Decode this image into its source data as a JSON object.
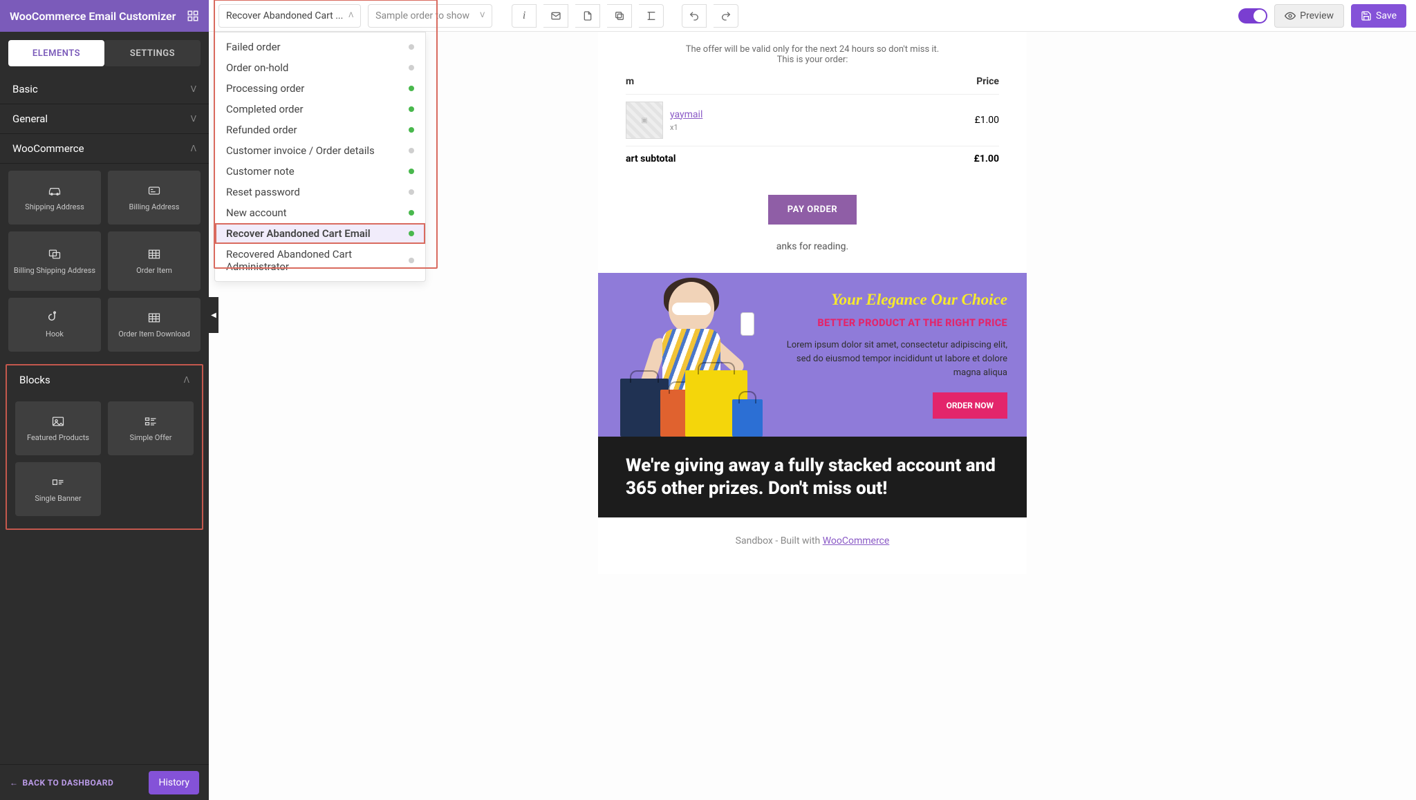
{
  "app": {
    "title": "WooCommerce Email Customizer"
  },
  "toolbar": {
    "template_dropdown": "Recover Abandoned Cart ...",
    "sample_dropdown": "Sample order to show",
    "preview_label": "Preview",
    "save_label": "Save"
  },
  "tabs": {
    "elements": "ELEMENTS",
    "settings": "SETTINGS"
  },
  "accordions": {
    "basic": "Basic",
    "general": "General",
    "woocommerce": "WooCommerce",
    "blocks": "Blocks"
  },
  "tiles": {
    "shipping_address": "Shipping Address",
    "billing_address": "Billing Address",
    "billing_shipping_address": "Billing Shipping Address",
    "order_item": "Order Item",
    "hook": "Hook",
    "order_item_download": "Order Item Download",
    "featured_products": "Featured Products",
    "simple_offer": "Simple Offer",
    "single_banner": "Single Banner"
  },
  "footer": {
    "back": "BACK TO DASHBOARD",
    "history": "History"
  },
  "dropdown_items": [
    {
      "label": "Failed order",
      "status": "gray"
    },
    {
      "label": "Order on-hold",
      "status": "gray"
    },
    {
      "label": "Processing order",
      "status": "green"
    },
    {
      "label": "Completed order",
      "status": "green"
    },
    {
      "label": "Refunded order",
      "status": "green"
    },
    {
      "label": "Customer invoice / Order details",
      "status": "gray"
    },
    {
      "label": "Customer note",
      "status": "green"
    },
    {
      "label": "Reset password",
      "status": "gray"
    },
    {
      "label": "New account",
      "status": "green"
    },
    {
      "label": "Recover Abandoned Cart Email",
      "status": "green",
      "selected": true
    },
    {
      "label": "Recovered Abandoned Cart Administrator",
      "status": "gray"
    }
  ],
  "email": {
    "offer_line1": "The offer will be valid only for the next 24 hours so don't miss it.",
    "offer_line2": "This is your order:",
    "col_item": "m",
    "col_price": "Price",
    "product_name": "yaymail",
    "product_qty": "x1",
    "product_price": "£1.00",
    "subtotal_label": "art subtotal",
    "subtotal_value": "£1.00",
    "pay_label": "PAY ORDER",
    "thanks": "anks for reading.",
    "banner_h1": "Your Elegance Our Choice",
    "banner_h2": "BETTER PRODUCT AT THE RIGHT PRICE",
    "banner_p": "Lorem ipsum dolor sit amet, consectetur adipiscing elit, sed do eiusmod tempor incididunt ut labore et dolore magna aliqua",
    "order_now": "ORDER NOW",
    "dark_text": "We're giving away a fully stacked account and 365 other prizes. Don't miss out!",
    "credit_prefix": "Sandbox - Built with ",
    "credit_link": "WooCommerce"
  }
}
